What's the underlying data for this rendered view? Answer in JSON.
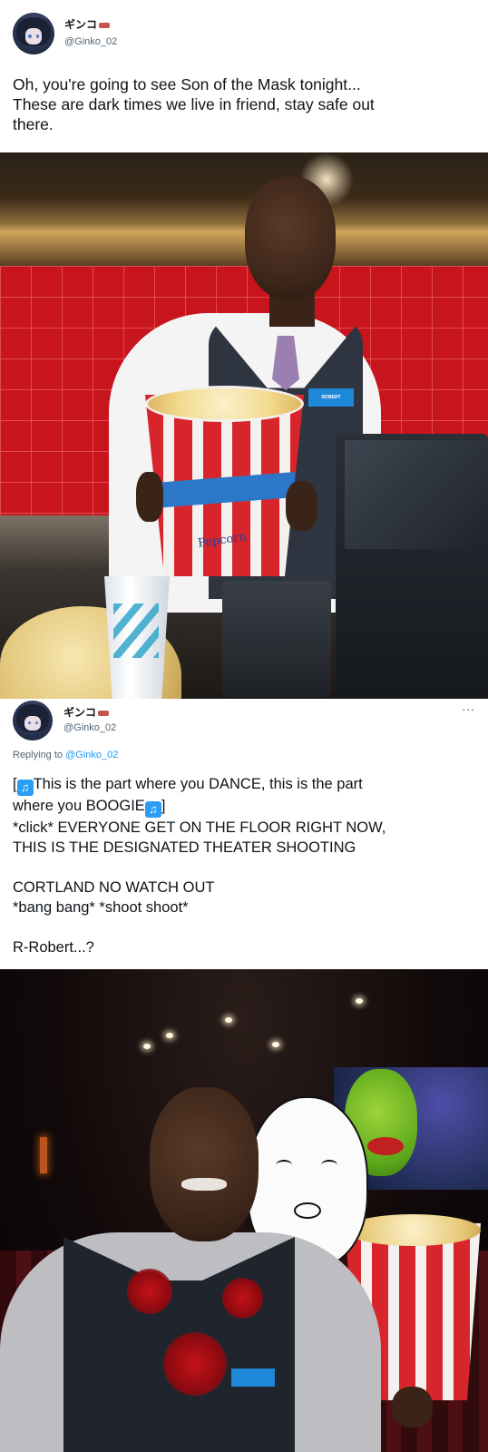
{
  "tweet": {
    "display_name": "ギンコ",
    "handle": "@Ginko_02",
    "text_lines": [
      "Oh, you're going to see Son of the Mask tonight...",
      "These are dark times we live in friend, stay safe out",
      "there."
    ],
    "image": {
      "name_badge": "ROBERT",
      "bucket_label": "Popcorn"
    }
  },
  "reply": {
    "display_name": "ギンコ",
    "handle": "@Ginko_02",
    "more": "...",
    "replying_prefix": "Replying to",
    "replying_handle": "@Ginko_02",
    "lines": [
      {
        "pre": "[",
        "icon": "♫",
        "text": "This is the part where you DANCE, this is the part"
      },
      {
        "text": "where you BOOGIE",
        "icon": "♫",
        "post": "]"
      },
      {
        "text": "*click* EVERYONE GET ON THE FLOOR RIGHT NOW,"
      },
      {
        "text": "THIS IS THE DESIGNATED THEATER SHOOTING"
      },
      {
        "text": ""
      },
      {
        "text": "CORTLAND NO WATCH OUT"
      },
      {
        "text": "*bang bang* *shoot shoot*"
      },
      {
        "text": ""
      },
      {
        "text": "R-Robert...?"
      }
    ]
  },
  "colors": {
    "link": "#1d9bf0",
    "secondary_text": "#536471",
    "tile_red": "#c8141c",
    "badge_blue": "#1e88d8"
  },
  "icons": [
    "music-note-icon",
    "more-options-icon",
    "flag-emoji-icon"
  ]
}
